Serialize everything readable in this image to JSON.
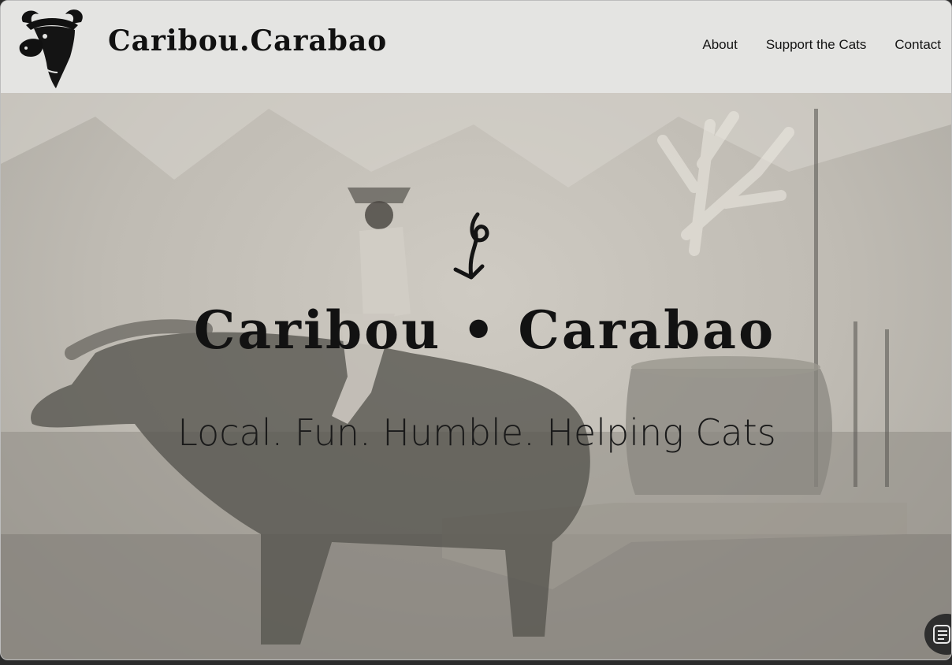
{
  "site": {
    "logo_icon": "water-buffalo-head",
    "brand": "Caribou.Carabao"
  },
  "nav": {
    "items": [
      "About",
      "Support the Cats",
      "Contact"
    ]
  },
  "hero": {
    "background": "sepia photo of a boy riding a water buffalo pulling a sled with a woven basket",
    "mark_icon": "cat-tail-swirl",
    "title": "Caribou • Carabao",
    "tagline": "Local. Fun. Humble. Helping Cats"
  },
  "floating_button": {
    "icon": "list-menu-icon"
  },
  "colors": {
    "header_bg": "#e4e4e2",
    "text": "#121212"
  }
}
